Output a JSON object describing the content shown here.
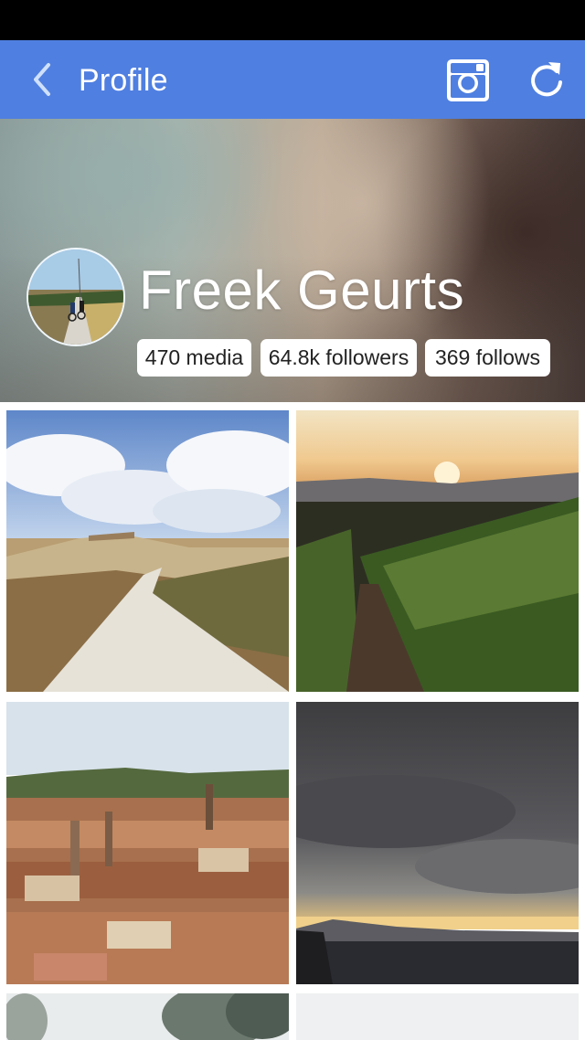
{
  "app_bar": {
    "title": "Profile",
    "color": "#4f7fe0",
    "icons": [
      "chevron-left-icon",
      "instagram-icon",
      "refresh-icon"
    ]
  },
  "profile": {
    "name": "Freek Geurts",
    "stats": {
      "media": "470 media",
      "followers": "64.8k followers",
      "follows": "369 follows"
    }
  },
  "grid": {
    "items": [
      {
        "name": "photo-gravel-road"
      },
      {
        "name": "photo-vineyard-sunset"
      },
      {
        "name": "photo-city-rooftops"
      },
      {
        "name": "photo-stormy-sea"
      },
      {
        "name": "photo-trees"
      },
      {
        "name": "photo-pale-sky"
      }
    ]
  }
}
